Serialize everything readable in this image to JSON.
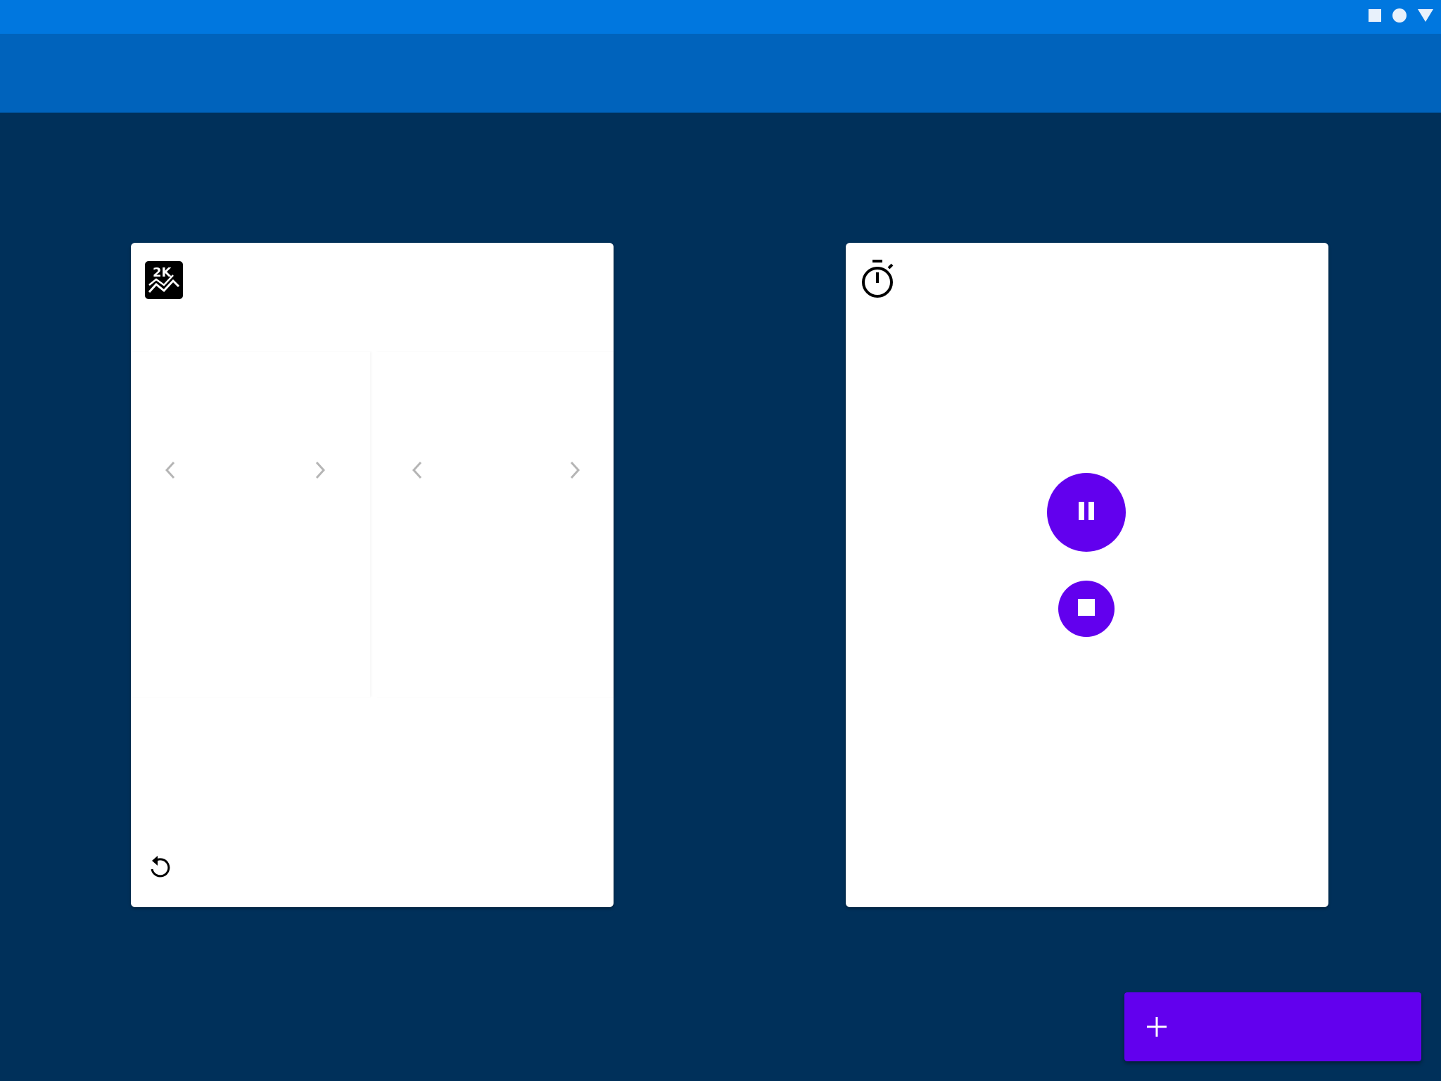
{
  "status_bar": {
    "icons": [
      "square-icon",
      "circle-icon",
      "triangle-down-icon"
    ]
  },
  "app_bar": {
    "title": ""
  },
  "cards": {
    "left": {
      "icon": "2k-chart-icon",
      "pickers": [
        {
          "prev_icon": "chevron-left-icon",
          "next_icon": "chevron-right-icon",
          "value": ""
        },
        {
          "prev_icon": "chevron-left-icon",
          "next_icon": "chevron-right-icon",
          "value": ""
        }
      ],
      "reset_icon": "replay-icon"
    },
    "right": {
      "icon": "stopwatch-icon",
      "pause_icon": "pause-icon",
      "stop_icon": "stop-icon"
    }
  },
  "fab": {
    "icon": "plus-icon",
    "label": ""
  },
  "colors": {
    "status_bar": "#0077df",
    "app_bar": "#0063bc",
    "background": "#00305a",
    "accent": "#6200ee",
    "card": "#ffffff"
  }
}
